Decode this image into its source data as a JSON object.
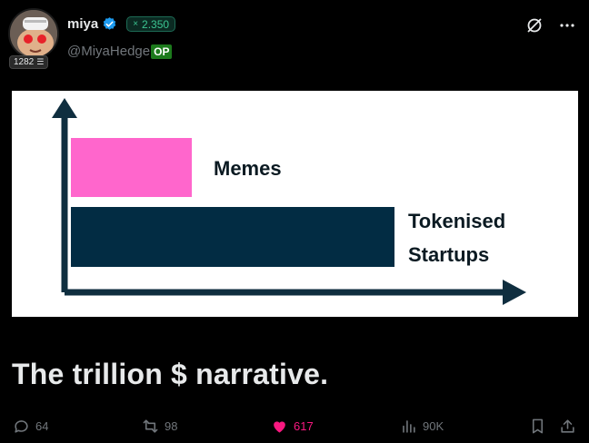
{
  "author": {
    "display_name": "miya",
    "handle": "@MiyaHedge",
    "op_badge": "OP",
    "follow_count": "2.350",
    "follow_prefix": "×",
    "avatar_badge": "1282"
  },
  "post": {
    "text": "The trillion $ narrative.",
    "image": {
      "labels": {
        "memes": "Memes",
        "tokenised_line1": "Tokenised",
        "tokenised_line2": "Startups"
      },
      "colors": {
        "memes_bar": "#ff66cc",
        "tokenised_bar": "#022c43",
        "axis": "#0f2e3f",
        "background": "#ffffff"
      },
      "values": {
        "memes": 0.27,
        "tokenised": 0.72
      }
    }
  },
  "actions": {
    "replies": "64",
    "reposts": "98",
    "likes": "617",
    "views": "90K"
  },
  "colors": {
    "background": "#000000",
    "text": "#e7e9ea",
    "muted": "#71767b",
    "verified": "#1d9bf0",
    "like": "#f91880",
    "op": "#1c7a1c"
  }
}
